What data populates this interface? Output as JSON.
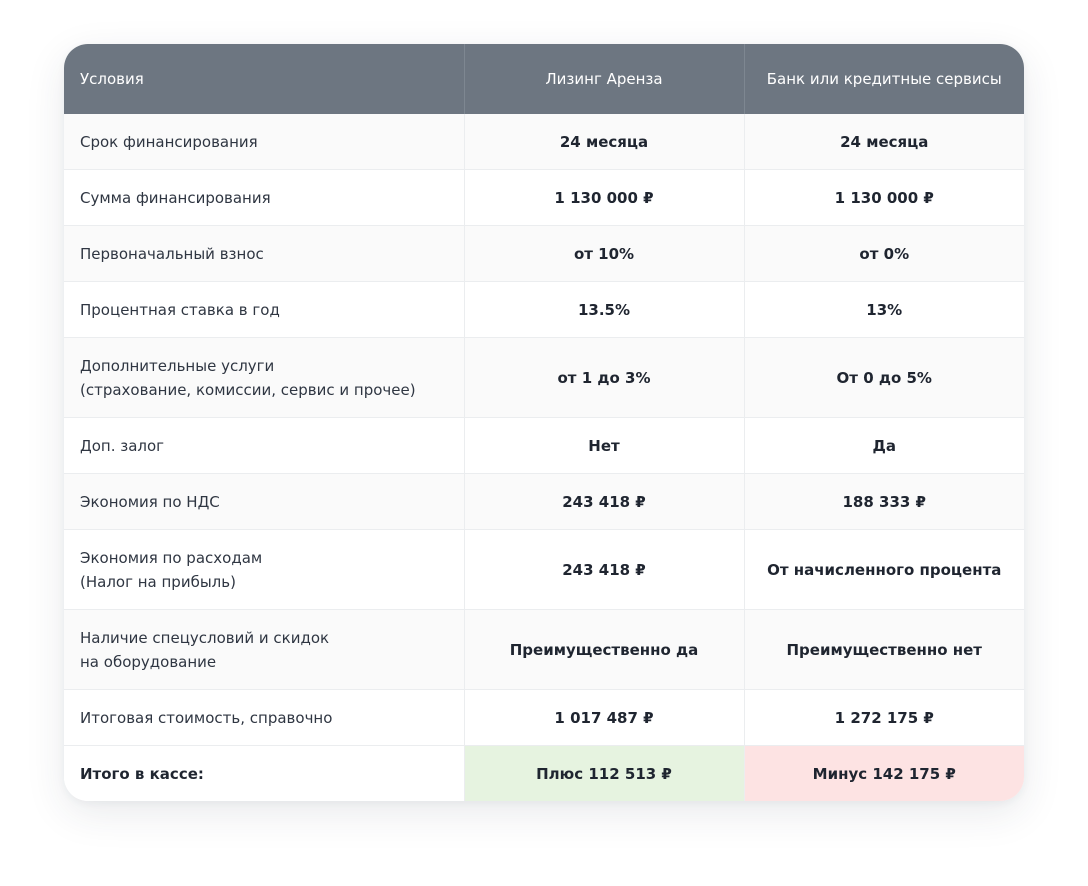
{
  "header": {
    "col_conditions": "Условия",
    "col_leasing": "Лизинг Аренза",
    "col_bank": "Банк или кредитные сервисы"
  },
  "rows": [
    {
      "label": [
        "Срок финансирования"
      ],
      "leasing": "24 месяца",
      "bank": "24 месяца"
    },
    {
      "label": [
        "Сумма финансирования"
      ],
      "leasing": "1 130 000 ₽",
      "bank": "1 130 000 ₽"
    },
    {
      "label": [
        "Первоначальный взнос"
      ],
      "leasing": "от 10%",
      "bank": "от 0%"
    },
    {
      "label": [
        "Процентная ставка в год"
      ],
      "leasing": "13.5%",
      "bank": "13%"
    },
    {
      "label": [
        "Дополнительные услуги",
        "(страхование, комиссии, сервис и прочее)"
      ],
      "leasing": "от 1 до 3%",
      "bank": "От 0 до 5%"
    },
    {
      "label": [
        "Доп. залог"
      ],
      "leasing": "Нет",
      "bank": "Да"
    },
    {
      "label": [
        "Экономия по НДС"
      ],
      "leasing": "243 418 ₽",
      "bank": "188 333 ₽"
    },
    {
      "label": [
        "Экономия по расходам",
        "(Налог на прибыль)"
      ],
      "leasing": "243 418 ₽",
      "bank": "От начисленного процента"
    },
    {
      "label": [
        "Наличие спецусловий и скидок",
        "на оборудование"
      ],
      "leasing": "Преимущественно да",
      "bank": "Преимущественно нет"
    },
    {
      "label": [
        "Итоговая стоимость, справочно"
      ],
      "leasing": "1 017 487 ₽",
      "bank": "1 272 175 ₽"
    }
  ],
  "total": {
    "label": "Итого в кассе:",
    "leasing": "Плюс 112 513 ₽",
    "bank": "Минус 142 175 ₽"
  },
  "colors": {
    "header_bg": "#6d7681",
    "plus_bg": "#e6f3e0",
    "minus_bg": "#fde3e3"
  }
}
